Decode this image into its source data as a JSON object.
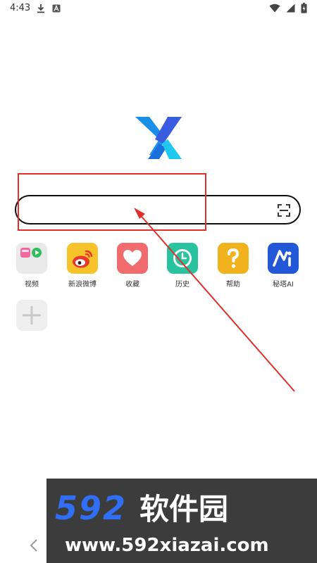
{
  "status_bar": {
    "time": "4:43",
    "icons_left": [
      "download-icon",
      "notification-a-icon"
    ],
    "icons_right": [
      "wifi-icon",
      "signal-icon",
      "battery-charging-icon"
    ]
  },
  "logo": {
    "letter": "X",
    "colors": [
      "#1a8fe8",
      "#3a5ce0",
      "#1fd1e6"
    ]
  },
  "search": {
    "value": "",
    "placeholder": "",
    "scan_icon": "scan-icon"
  },
  "shortcuts": [
    {
      "label": "视频",
      "icon": "video-folder-icon"
    },
    {
      "label": "新浪微博",
      "icon": "weibo-icon"
    },
    {
      "label": "收藏",
      "icon": "heart-icon"
    },
    {
      "label": "历史",
      "icon": "clock-icon"
    },
    {
      "label": "帮助",
      "icon": "question-icon"
    },
    {
      "label": "秘塔AI",
      "icon": "metaso-ai-icon"
    }
  ],
  "add_shortcut": {
    "icon": "plus-icon"
  },
  "annotation": {
    "highlight_color": "#e0302c"
  },
  "watermark": {
    "number": "592",
    "brand": "软件园",
    "url": "www.592xiazai.com"
  },
  "nav": {
    "back_icon": "chevron-left-icon"
  }
}
